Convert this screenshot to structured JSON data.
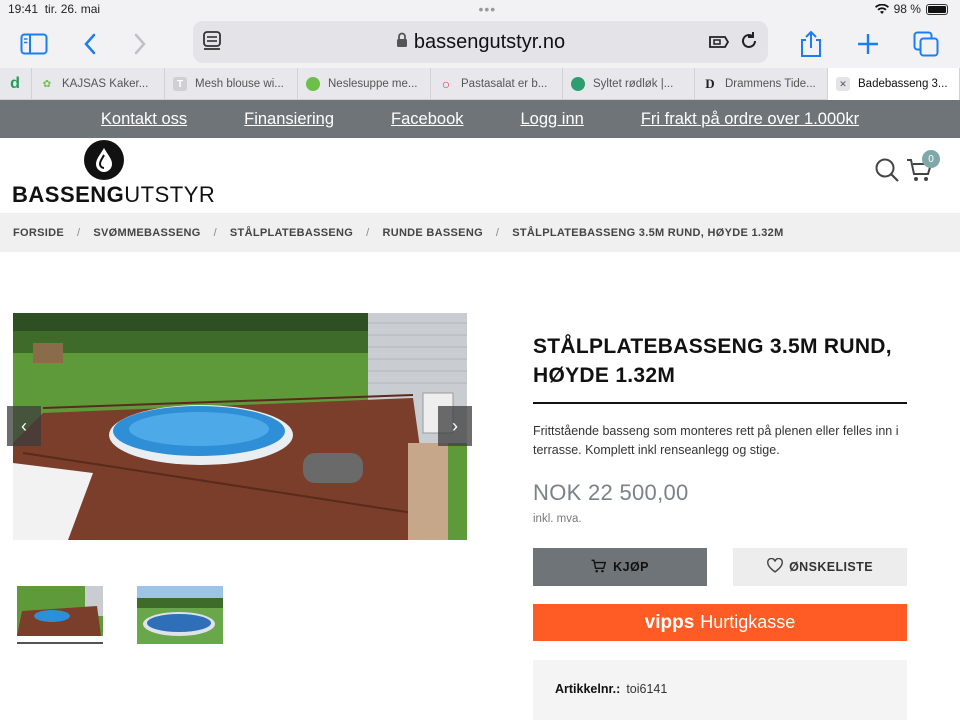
{
  "status": {
    "time": "19:41",
    "date": "tir. 26. mai",
    "battery": "98 %",
    "battery_level": 0.98
  },
  "browser": {
    "url": "bassengutstyr.no"
  },
  "tabs": [
    {
      "label": "",
      "fav_color": "#1f9d55",
      "fav_char": "d"
    },
    {
      "label": "KAJSAS Kaker...",
      "fav_color": "#e8e8ec",
      "fav_char": "✿"
    },
    {
      "label": "Mesh blouse wi...",
      "fav_color": "#d0d0d4",
      "fav_char": "T"
    },
    {
      "label": "Neslesuppe me...",
      "fav_color": "#6cbf4a",
      "fav_char": "●"
    },
    {
      "label": "Pastasalat er b...",
      "fav_color": "#ffffff",
      "fav_char": "○"
    },
    {
      "label": "Syltet rødløk |...",
      "fav_color": "#2e9e6e",
      "fav_char": "●"
    },
    {
      "label": "Drammens Tide...",
      "fav_color": "#ffffff",
      "fav_char": "D"
    },
    {
      "label": "Badebasseng 3...",
      "fav_color": "#ffffff",
      "fav_char": "✕"
    }
  ],
  "topnav": [
    "Kontakt oss",
    "Finansiering",
    "Facebook",
    "Logg inn",
    "Fri frakt på ordre over 1.000kr"
  ],
  "logo": {
    "bold": "BASSENG",
    "light": "UTSTYR"
  },
  "cart": {
    "count": "0"
  },
  "breadcrumb": [
    "FORSIDE",
    "SVØMMEBASSENG",
    "STÅLPLATEBASSENG",
    "RUNDE BASSENG",
    "STÅLPLATEBASSENG 3.5M RUND, HØYDE 1.32M"
  ],
  "product": {
    "title": "STÅLPLATEBASSENG 3.5M RUND, HØYDE 1.32M",
    "description": "Frittstående basseng som monteres rett på plenen eller felles inn i terrasse. Komplett inkl renseanlegg og stige.",
    "price": "NOK 22 500,00",
    "vat": "inkl. mva.",
    "buy_label": "KJØP",
    "wish_label": "ØNSKELISTE",
    "vipps_brand": "vipps",
    "vipps_label": "Hurtigkasse",
    "article_label": "Artikkelnr.:",
    "article_no": "toi6141"
  }
}
